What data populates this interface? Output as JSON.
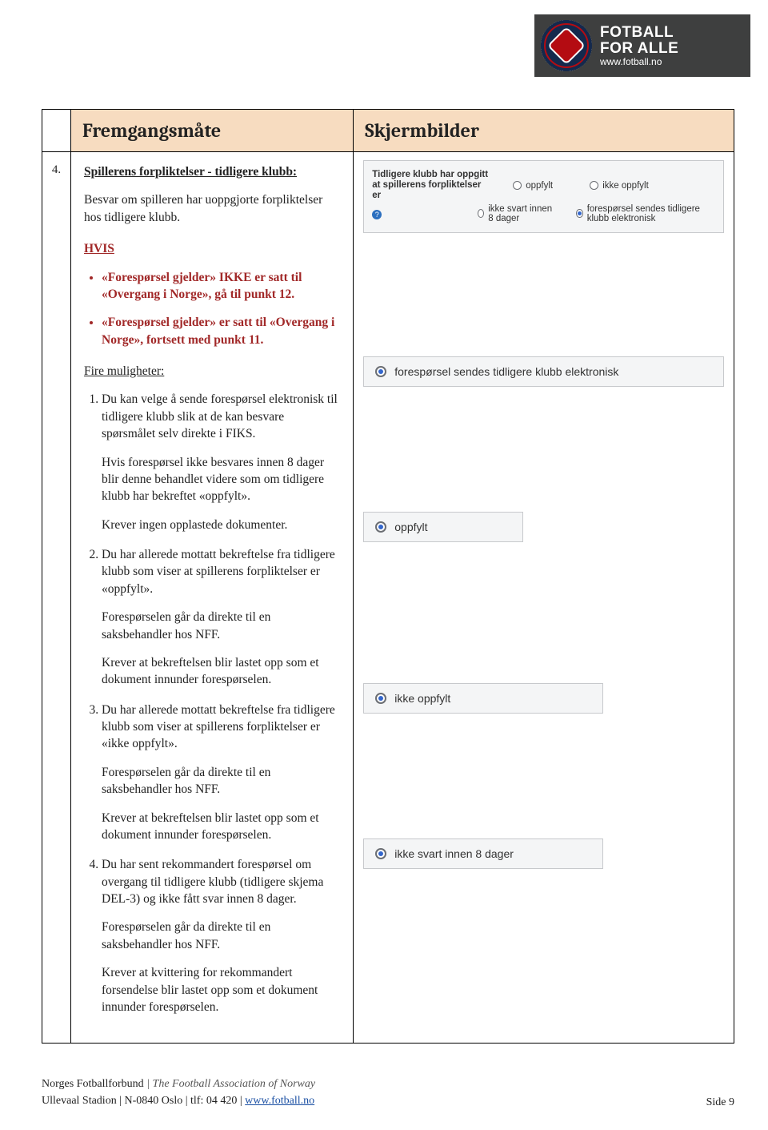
{
  "brand": {
    "line1": "FOTBALL",
    "line2": "FOR ALLE",
    "url": "www.fotball.no"
  },
  "step_number": "4.",
  "header": {
    "left": "Fremgangsmåte",
    "right": "Skjermbilder"
  },
  "section": {
    "title": "Spillerens forpliktelser - tidligere klubb:",
    "intro": "Besvar om spilleren har uoppgjorte forpliktelser hos tidligere klubb.",
    "hvis": "HVIS",
    "bullets": [
      "«Forespørsel gjelder» IKKE er satt til «Overgang i Norge», gå til punkt 12.",
      "«Forespørsel gjelder» er satt til «Overgang i Norge», fortsett med punkt 11."
    ],
    "fire": "Fire muligheter:",
    "items": [
      {
        "main": "Du kan velge å sende forespørsel elektronisk til tidligere klubb slik at de kan besvare spørsmålet selv direkte i FIKS.",
        "sub1": "Hvis forespørsel ikke besvares innen 8 dager blir denne behandlet videre som om tidligere klubb har bekreftet «oppfylt».",
        "sub2": "Krever ingen opplastede dokumenter."
      },
      {
        "main": "Du har allerede mottatt bekreftelse fra tidligere klubb som viser at spillerens forpliktelser er «oppfylt».",
        "sub1": "Forespørselen går da direkte til en saksbehandler hos NFF.",
        "sub2": "Krever at bekreftelsen blir lastet opp som et dokument innunder forespørselen."
      },
      {
        "main": "Du har allerede mottatt bekreftelse fra tidligere klubb som viser at spillerens forpliktelser er «ikke oppfylt».",
        "sub1": "Forespørselen går da direkte til en saksbehandler hos NFF.",
        "sub2": "Krever at bekreftelsen blir lastet opp som et dokument innunder forespørselen."
      },
      {
        "main": "Du har sent rekommandert forespørsel om overgang til tidligere klubb (tidligere skjema DEL-3) og ikke fått svar innen 8 dager.",
        "sub1": "Forespørselen går da direkte til en saksbehandler hos NFF.",
        "sub2": "Krever at kvittering for rekommandert forsendelse blir lastet opp som et dokument innunder forespørselen."
      }
    ]
  },
  "topbox": {
    "label": "Tidligere klubb har oppgitt at spillerens forpliktelser er",
    "row1": [
      "oppfylt",
      "ikke oppfylt"
    ],
    "row2": [
      "ikke svart innen 8 dager",
      "forespørsel sendes tidligere klubb elektronisk"
    ]
  },
  "radios": [
    "forespørsel sendes tidligere klubb elektronisk",
    "oppfylt",
    "ikke oppfylt",
    "ikke svart innen 8 dager"
  ],
  "footer": {
    "org_no": "Norges Fotballforbund",
    "org_en": " | The Football Association of Norway",
    "addr": "Ullevaal Stadion | N-0840 Oslo | tlf: 04 420 | ",
    "link": "www.fotball.no",
    "page": "Side 9"
  }
}
